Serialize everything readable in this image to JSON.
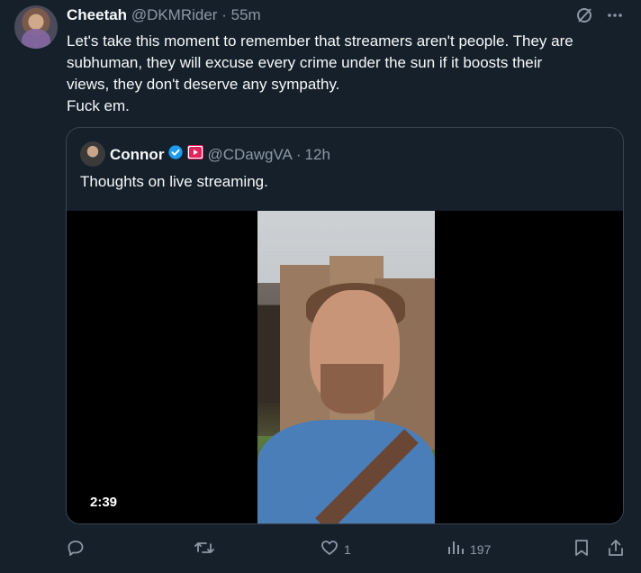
{
  "tweet": {
    "author_name": "Cheetah",
    "author_handle": "@DKMRider",
    "separator": "·",
    "time": "55m",
    "lines": [
      "Let's take this moment to remember that streamers aren't people. They are",
      "subhuman, they will excuse every crime under the sun if it boosts their",
      "views, they don't deserve any sympathy.",
      "Fuck em."
    ]
  },
  "quote": {
    "author_name": "Connor",
    "author_handle": "@CDawgVA",
    "separator": "·",
    "time": "12h",
    "text": "Thoughts on live streaming.",
    "video_duration": "2:39"
  },
  "actions": {
    "like_count": "1",
    "views_count": "197"
  },
  "icons": {
    "grok": "slash-circle-icon",
    "more": "more-dots-icon",
    "verified": "verified-badge-icon",
    "youtube": "youtube-icon",
    "reply": "reply-icon",
    "retweet": "retweet-icon",
    "like": "heart-icon",
    "views": "views-bar-icon",
    "bookmark": "bookmark-icon",
    "share": "share-icon"
  },
  "colors": {
    "background": "#15202b",
    "text": "#f7f9f9",
    "muted": "#8b98a5",
    "verified": "#1d9bf0",
    "border": "#38444d"
  }
}
